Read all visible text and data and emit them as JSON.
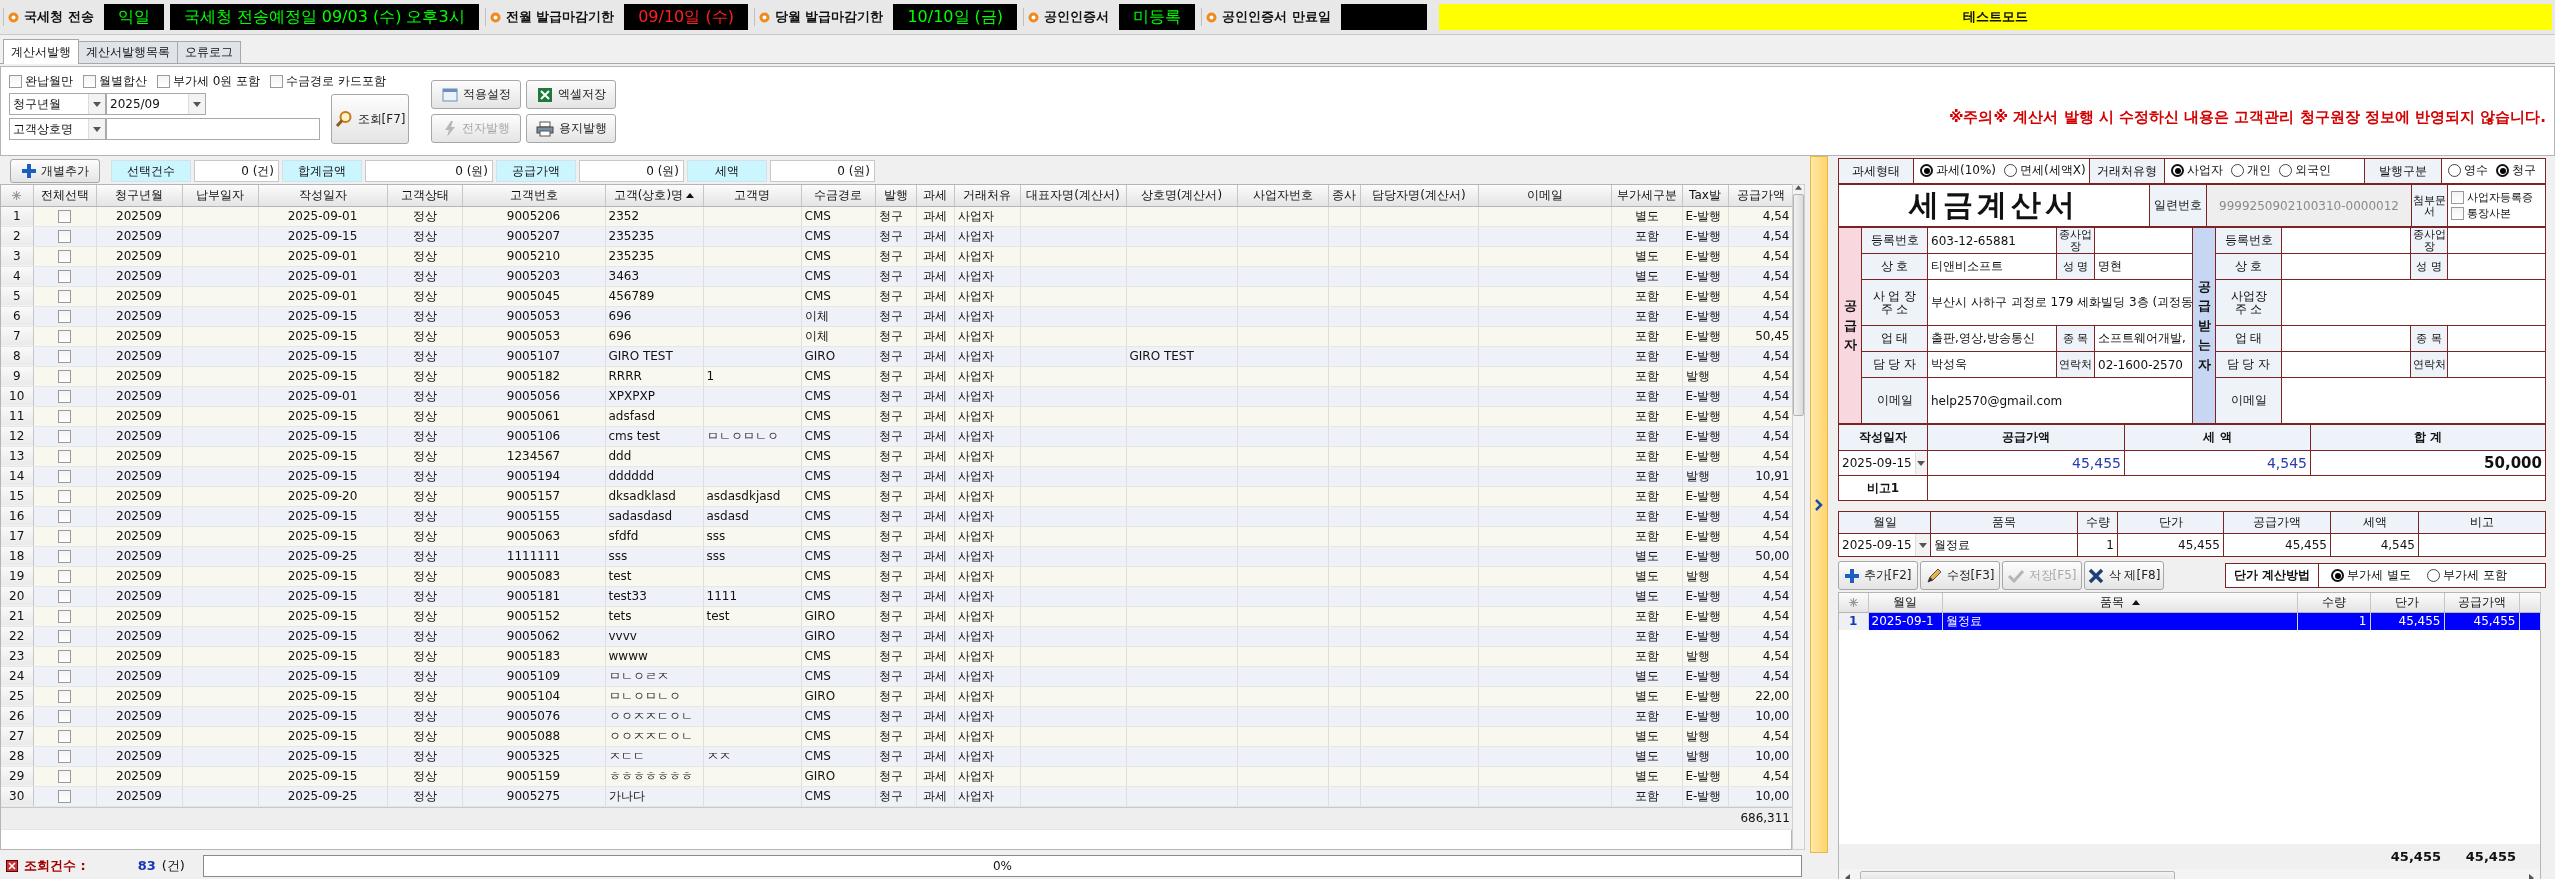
{
  "status_strip": {
    "items": [
      {
        "kind": "label",
        "text": "국세청 전송"
      },
      {
        "kind": "value",
        "text": "익일",
        "warning": false
      },
      {
        "kind": "value",
        "text": "국세청 전송예정일 09/03 (수) 오후3시",
        "warning": false
      },
      {
        "kind": "label",
        "text": "전월 발급마감기한"
      },
      {
        "kind": "value",
        "text": "09/10일 (수)",
        "warning": true
      },
      {
        "kind": "label",
        "text": "당월 발급마감기한"
      },
      {
        "kind": "value",
        "text": "10/10일 (금)",
        "warning": false
      },
      {
        "kind": "label",
        "text": "공인인증서"
      },
      {
        "kind": "value",
        "text": "미등록",
        "warning": false
      },
      {
        "kind": "label",
        "text": "공인인증서 만료일"
      },
      {
        "kind": "blank"
      }
    ],
    "mode_banner": "테스트모드"
  },
  "tabs": [
    {
      "label": "계산서발행",
      "selected": true
    },
    {
      "label": "계산서발행목록",
      "selected": false
    },
    {
      "label": "오류로그",
      "selected": false
    }
  ],
  "filter": {
    "checkboxes": [
      {
        "label": "완납월만",
        "checked": false
      },
      {
        "label": "월별합산",
        "checked": false
      },
      {
        "label": "부가세 0원 포함",
        "checked": false
      },
      {
        "label": "수금경로 카드포함",
        "checked": false
      }
    ],
    "period": {
      "type": "청구년월",
      "value": "2025/09"
    },
    "search": {
      "type": "고객상호명"
    },
    "search_button": {
      "label": "조회[F7]"
    },
    "buttons": [
      {
        "label": "적용설정",
        "kind": "apply",
        "disabled": false
      },
      {
        "label": "엑셀저장",
        "kind": "excel",
        "disabled": false
      },
      {
        "label": "전자발행",
        "kind": "esign",
        "disabled": true
      },
      {
        "label": "용지발행",
        "kind": "print",
        "disabled": false
      }
    ],
    "notice": "※주의※ 계산서 발행 시 수정하신 내용은 고객관리 청구원장 정보에 반영되지 않습니다."
  },
  "summary": {
    "add_button": "개별추가",
    "fields": [
      {
        "label": "선택건수",
        "value": "0 (건)"
      },
      {
        "label": "합계금액",
        "value": "0 (원)"
      },
      {
        "label": "공급가액",
        "value": "0 (원)"
      },
      {
        "label": "세액",
        "value": "0 (원)"
      }
    ]
  },
  "table": {
    "columns": [
      {
        "kind": "rownum",
        "sorted": false
      },
      {
        "kind": "check",
        "label": "전체선택",
        "sorted": false
      },
      {
        "label": "청구년월",
        "kind": "center",
        "sorted": false
      },
      {
        "label": "납부일자",
        "kind": "center",
        "sorted": false
      },
      {
        "label": "작성일자",
        "kind": "center",
        "sorted": false
      },
      {
        "label": "고객상태",
        "kind": "center",
        "sorted": false
      },
      {
        "label": "고객번호",
        "kind": "center",
        "sorted": false
      },
      {
        "label": "고객(상호)명",
        "kind": "text",
        "sorted": true
      },
      {
        "label": "고객명",
        "kind": "text",
        "sorted": false
      },
      {
        "label": "수금경로",
        "kind": "text",
        "sorted": false
      },
      {
        "label": "발행",
        "kind": "text",
        "sorted": false
      },
      {
        "label": "과세",
        "kind": "center",
        "sorted": false
      },
      {
        "label": "거래처유",
        "kind": "text",
        "sorted": false
      },
      {
        "label": "대표자명(계산서)",
        "kind": "text",
        "sorted": false
      },
      {
        "label": "상호명(계산서)",
        "kind": "text",
        "sorted": false
      },
      {
        "label": "사업자번호",
        "kind": "text",
        "sorted": false
      },
      {
        "label": "종사",
        "kind": "text",
        "sorted": false
      },
      {
        "label": "담당자명(계산서)",
        "kind": "text",
        "sorted": false
      },
      {
        "label": "이메일",
        "kind": "text",
        "sorted": false
      },
      {
        "label": "부가세구분",
        "kind": "center",
        "sorted": false
      },
      {
        "label": "Tax발",
        "kind": "text",
        "sorted": false
      },
      {
        "label": "공급가액",
        "kind": "number",
        "sorted": false
      }
    ],
    "rows": [
      {
        "num": "1",
        "checked": false,
        "billing_month": "202509",
        "issue_date": "2025-09-01",
        "status": "정상",
        "customer_no": "9005206",
        "customer_name": "2352",
        "route": "CMS",
        "issue_kind": "청구",
        "tax_form": "과세",
        "partner_type": "사업자",
        "vat": "별도",
        "tax_issue": "E-발행",
        "supply": "4,54"
      },
      {
        "num": "2",
        "checked": false,
        "billing_month": "202509",
        "issue_date": "2025-09-15",
        "status": "정상",
        "customer_no": "9005207",
        "customer_name": "235235",
        "route": "CMS",
        "issue_kind": "청구",
        "tax_form": "과세",
        "partner_type": "사업자",
        "vat": "포함",
        "tax_issue": "E-발행",
        "supply": "4,54"
      },
      {
        "num": "3",
        "checked": false,
        "billing_month": "202509",
        "issue_date": "2025-09-01",
        "status": "정상",
        "customer_no": "9005210",
        "customer_name": "235235",
        "route": "CMS",
        "issue_kind": "청구",
        "tax_form": "과세",
        "partner_type": "사업자",
        "vat": "별도",
        "tax_issue": "E-발행",
        "supply": "4,54"
      },
      {
        "num": "4",
        "checked": false,
        "billing_month": "202509",
        "issue_date": "2025-09-01",
        "status": "정상",
        "customer_no": "9005203",
        "customer_name": "3463",
        "route": "CMS",
        "issue_kind": "청구",
        "tax_form": "과세",
        "partner_type": "사업자",
        "vat": "별도",
        "tax_issue": "E-발행",
        "supply": "4,54"
      },
      {
        "num": "5",
        "checked": false,
        "billing_month": "202509",
        "issue_date": "2025-09-01",
        "status": "정상",
        "customer_no": "9005045",
        "customer_name": "456789",
        "route": "CMS",
        "issue_kind": "청구",
        "tax_form": "과세",
        "partner_type": "사업자",
        "vat": "포함",
        "tax_issue": "E-발행",
        "supply": "4,54"
      },
      {
        "num": "6",
        "checked": false,
        "billing_month": "202509",
        "issue_date": "2025-09-15",
        "status": "정상",
        "customer_no": "9005053",
        "customer_name": "696",
        "route": "이체",
        "issue_kind": "청구",
        "tax_form": "과세",
        "partner_type": "사업자",
        "vat": "포함",
        "tax_issue": "E-발행",
        "supply": "4,54"
      },
      {
        "num": "7",
        "checked": false,
        "billing_month": "202509",
        "issue_date": "2025-09-15",
        "status": "정상",
        "customer_no": "9005053",
        "customer_name": "696",
        "route": "이체",
        "issue_kind": "청구",
        "tax_form": "과세",
        "partner_type": "사업자",
        "vat": "포함",
        "tax_issue": "E-발행",
        "supply": "50,45"
      },
      {
        "num": "8",
        "checked": false,
        "billing_month": "202509",
        "issue_date": "2025-09-15",
        "status": "정상",
        "customer_no": "9005107",
        "customer_name": "GIRO TEST",
        "route": "GIRO",
        "issue_kind": "청구",
        "tax_form": "과세",
        "partner_type": "사업자",
        "company_name": "GIRO TEST",
        "vat": "포함",
        "tax_issue": "E-발행",
        "supply": "4,54"
      },
      {
        "num": "9",
        "checked": false,
        "billing_month": "202509",
        "issue_date": "2025-09-15",
        "status": "정상",
        "customer_no": "9005182",
        "customer_name": "RRRR",
        "contact_name": "1",
        "route": "CMS",
        "issue_kind": "청구",
        "tax_form": "과세",
        "partner_type": "사업자",
        "vat": "포함",
        "tax_issue": "발행",
        "supply": "4,54"
      },
      {
        "num": "10",
        "checked": false,
        "billing_month": "202509",
        "issue_date": "2025-09-01",
        "status": "정상",
        "customer_no": "9005056",
        "customer_name": "XPXPXP",
        "route": "CMS",
        "issue_kind": "청구",
        "tax_form": "과세",
        "partner_type": "사업자",
        "vat": "포함",
        "tax_issue": "E-발행",
        "supply": "4,54"
      },
      {
        "num": "11",
        "checked": false,
        "billing_month": "202509",
        "issue_date": "2025-09-15",
        "status": "정상",
        "customer_no": "9005061",
        "customer_name": "adsfasd",
        "route": "CMS",
        "issue_kind": "청구",
        "tax_form": "과세",
        "partner_type": "사업자",
        "vat": "포함",
        "tax_issue": "E-발행",
        "supply": "4,54"
      },
      {
        "num": "12",
        "checked": false,
        "billing_month": "202509",
        "issue_date": "2025-09-15",
        "status": "정상",
        "customer_no": "9005106",
        "customer_name": "cms test",
        "contact_name": "ㅁㄴㅇㅁㄴㅇ",
        "route": "CMS",
        "issue_kind": "청구",
        "tax_form": "과세",
        "partner_type": "사업자",
        "vat": "포함",
        "tax_issue": "E-발행",
        "supply": "4,54"
      },
      {
        "num": "13",
        "checked": false,
        "billing_month": "202509",
        "issue_date": "2025-09-15",
        "status": "정상",
        "customer_no": "1234567",
        "customer_name": "ddd",
        "route": "CMS",
        "issue_kind": "청구",
        "tax_form": "과세",
        "partner_type": "사업자",
        "vat": "포함",
        "tax_issue": "E-발행",
        "supply": "4,54"
      },
      {
        "num": "14",
        "checked": false,
        "billing_month": "202509",
        "issue_date": "2025-09-15",
        "status": "정상",
        "customer_no": "9005194",
        "customer_name": "dddddd",
        "route": "CMS",
        "issue_kind": "청구",
        "tax_form": "과세",
        "partner_type": "사업자",
        "vat": "포함",
        "tax_issue": "발행",
        "supply": "10,91"
      },
      {
        "num": "15",
        "checked": false,
        "billing_month": "202509",
        "issue_date": "2025-09-20",
        "status": "정상",
        "customer_no": "9005157",
        "customer_name": "dksadklasd",
        "contact_name": "asdasdkjasd",
        "route": "CMS",
        "issue_kind": "청구",
        "tax_form": "과세",
        "partner_type": "사업자",
        "vat": "포함",
        "tax_issue": "E-발행",
        "supply": "4,54"
      },
      {
        "num": "16",
        "checked": false,
        "billing_month": "202509",
        "issue_date": "2025-09-15",
        "status": "정상",
        "customer_no": "9005155",
        "customer_name": "sadasdasd",
        "contact_name": "asdasd",
        "route": "CMS",
        "issue_kind": "청구",
        "tax_form": "과세",
        "partner_type": "사업자",
        "vat": "포함",
        "tax_issue": "E-발행",
        "supply": "4,54"
      },
      {
        "num": "17",
        "checked": false,
        "billing_month": "202509",
        "issue_date": "2025-09-15",
        "status": "정상",
        "customer_no": "9005063",
        "customer_name": "sfdfd",
        "contact_name": "sss",
        "route": "CMS",
        "issue_kind": "청구",
        "tax_form": "과세",
        "partner_type": "사업자",
        "vat": "포함",
        "tax_issue": "E-발행",
        "supply": "4,54"
      },
      {
        "num": "18",
        "checked": false,
        "billing_month": "202509",
        "issue_date": "2025-09-25",
        "status": "정상",
        "customer_no": "1111111",
        "customer_name": "sss",
        "contact_name": "sss",
        "route": "CMS",
        "issue_kind": "청구",
        "tax_form": "과세",
        "partner_type": "사업자",
        "vat": "별도",
        "tax_issue": "E-발행",
        "supply": "50,00"
      },
      {
        "num": "19",
        "checked": false,
        "billing_month": "202509",
        "issue_date": "2025-09-15",
        "status": "정상",
        "customer_no": "9005083",
        "customer_name": "test",
        "route": "CMS",
        "issue_kind": "청구",
        "tax_form": "과세",
        "partner_type": "사업자",
        "vat": "별도",
        "tax_issue": "발행",
        "supply": "4,54"
      },
      {
        "num": "20",
        "checked": false,
        "billing_month": "202509",
        "issue_date": "2025-09-15",
        "status": "정상",
        "customer_no": "9005181",
        "customer_name": "test33",
        "contact_name": "1111",
        "route": "CMS",
        "issue_kind": "청구",
        "tax_form": "과세",
        "partner_type": "사업자",
        "vat": "별도",
        "tax_issue": "E-발행",
        "supply": "4,54"
      },
      {
        "num": "21",
        "checked": false,
        "billing_month": "202509",
        "issue_date": "2025-09-15",
        "status": "정상",
        "customer_no": "9005152",
        "customer_name": "tets",
        "contact_name": "test",
        "route": "GIRO",
        "issue_kind": "청구",
        "tax_form": "과세",
        "partner_type": "사업자",
        "vat": "포함",
        "tax_issue": "E-발행",
        "supply": "4,54"
      },
      {
        "num": "22",
        "checked": false,
        "billing_month": "202509",
        "issue_date": "2025-09-15",
        "status": "정상",
        "customer_no": "9005062",
        "customer_name": "vvvv",
        "route": "GIRO",
        "issue_kind": "청구",
        "tax_form": "과세",
        "partner_type": "사업자",
        "vat": "포함",
        "tax_issue": "E-발행",
        "supply": "4,54"
      },
      {
        "num": "23",
        "checked": false,
        "billing_month": "202509",
        "issue_date": "2025-09-15",
        "status": "정상",
        "customer_no": "9005183",
        "customer_name": "wwww",
        "route": "CMS",
        "issue_kind": "청구",
        "tax_form": "과세",
        "partner_type": "사업자",
        "vat": "포함",
        "tax_issue": "발행",
        "supply": "4,54"
      },
      {
        "num": "24",
        "checked": false,
        "billing_month": "202509",
        "issue_date": "2025-09-15",
        "status": "정상",
        "customer_no": "9005109",
        "customer_name": "ㅁㄴㅇㄹㅈ",
        "route": "CMS",
        "issue_kind": "청구",
        "tax_form": "과세",
        "partner_type": "사업자",
        "vat": "별도",
        "tax_issue": "E-발행",
        "supply": "4,54"
      },
      {
        "num": "25",
        "checked": false,
        "billing_month": "202509",
        "issue_date": "2025-09-15",
        "status": "정상",
        "customer_no": "9005104",
        "customer_name": "ㅁㄴㅇㅁㄴㅇ",
        "route": "GIRO",
        "issue_kind": "청구",
        "tax_form": "과세",
        "partner_type": "사업자",
        "vat": "별도",
        "tax_issue": "E-발행",
        "supply": "22,00"
      },
      {
        "num": "26",
        "checked": false,
        "billing_month": "202509",
        "issue_date": "2025-09-15",
        "status": "정상",
        "customer_no": "9005076",
        "customer_name": "ㅇㅇㅈㅈㄷㅇㄴ",
        "route": "CMS",
        "issue_kind": "청구",
        "tax_form": "과세",
        "partner_type": "사업자",
        "vat": "포함",
        "tax_issue": "E-발행",
        "supply": "10,00"
      },
      {
        "num": "27",
        "checked": false,
        "billing_month": "202509",
        "issue_date": "2025-09-15",
        "status": "정상",
        "customer_no": "9005088",
        "customer_name": "ㅇㅇㅈㅈㄷㅇㄴ",
        "route": "CMS",
        "issue_kind": "청구",
        "tax_form": "과세",
        "partner_type": "사업자",
        "vat": "별도",
        "tax_issue": "발행",
        "supply": "4,54"
      },
      {
        "num": "28",
        "checked": false,
        "billing_month": "202509",
        "issue_date": "2025-09-15",
        "status": "정상",
        "customer_no": "9005325",
        "customer_name": "ㅈㄷㄷ",
        "contact_name": "ㅈㅈ",
        "route": "CMS",
        "issue_kind": "청구",
        "tax_form": "과세",
        "partner_type": "사업자",
        "vat": "별도",
        "tax_issue": "발행",
        "supply": "10,00"
      },
      {
        "num": "29",
        "checked": false,
        "billing_month": "202509",
        "issue_date": "2025-09-15",
        "status": "정상",
        "customer_no": "9005159",
        "customer_name": "ㅎㅎㅎㅎㅎㅎㅎ",
        "route": "GIRO",
        "issue_kind": "청구",
        "tax_form": "과세",
        "partner_type": "사업자",
        "vat": "별도",
        "tax_issue": "E-발행",
        "supply": "4,54"
      },
      {
        "num": "30",
        "checked": false,
        "billing_month": "202509",
        "issue_date": "2025-09-25",
        "status": "정상",
        "customer_no": "9005275",
        "customer_name": "가나다",
        "route": "CMS",
        "issue_kind": "청구",
        "tax_form": "과세",
        "partner_type": "사업자",
        "vat": "포함",
        "tax_issue": "E-발행",
        "supply": "10,00"
      }
    ],
    "footer": {
      "supply": "686,311"
    }
  },
  "status_bar": {
    "label": "조회건수 :",
    "count": "83",
    "unit": "(건)",
    "progress": {
      "level": 0,
      "reading": "0%"
    }
  },
  "invoice": {
    "options": [
      {
        "label": "과세형태",
        "choices": [
          {
            "label": "과세(10%)",
            "selected": true
          },
          {
            "label": "면세(세액X)",
            "selected": false
          }
        ]
      },
      {
        "label": "거래처유형",
        "choices": [
          {
            "label": "사업자",
            "selected": true
          },
          {
            "label": "개인",
            "selected": false
          },
          {
            "label": "외국인",
            "selected": false
          }
        ]
      },
      {
        "label": "발행구분",
        "choices": [
          {
            "label": "영수",
            "selected": false
          },
          {
            "label": "청구",
            "selected": true
          }
        ]
      }
    ],
    "title": "세금계산서",
    "serial_label": "일련번호",
    "serial": "9999250902100310-0000012",
    "attachments_label": "첨부문서",
    "attachments": [
      {
        "label": "사업자등록증",
        "checked": false
      },
      {
        "label": "통장사본",
        "checked": false
      }
    ],
    "parties": [
      {
        "heading": "공급자",
        "color": "#f8d7df",
        "rows": [
          {
            "label": "등록번호",
            "value": "603-12-65881",
            "label2": "종사업장"
          },
          {
            "label": "상 호",
            "value": "티앤비소프트",
            "label2": "성 명",
            "value2": "명현"
          },
          {
            "label": "사 업 장\n주 소",
            "value": "부산시 사하구 괴정로 179 세화빌딩 3층 (괴정동"
          },
          {
            "label": "업 태",
            "value": "출판,영상,방송통신",
            "label2": "종 목",
            "value2": "소프트웨어개발,"
          },
          {
            "label": "담 당 자",
            "value": "박성욱",
            "label2": "연락처",
            "value2": "02-1600-2570"
          },
          {
            "label": "이메일",
            "value": "help2570@gmail.com"
          }
        ]
      },
      {
        "heading": "공급받는자",
        "color": "#c6d6f3",
        "rows": [
          {
            "label": "등록번호",
            "label2": "종사업장"
          },
          {
            "label": "상 호",
            "label2": "성 명"
          },
          {
            "label": "사업장\n주 소"
          },
          {
            "label": "업 태",
            "label2": "종 목"
          },
          {
            "label": "담 당 자",
            "label2": "연락처"
          },
          {
            "label": "이메일"
          }
        ]
      }
    ],
    "totals": {
      "columns": [
        "작성일자",
        "공급가액",
        "세 액",
        "합 계"
      ],
      "date": "2025-09-15",
      "supply": "45,455",
      "tax": "4,545",
      "total": "50,000",
      "remark_label": "비고1"
    },
    "items": {
      "columns": [
        {
          "label": "월일",
          "kind": "date"
        },
        {
          "label": "품목",
          "kind": "text"
        },
        {
          "label": "수량",
          "kind": "number"
        },
        {
          "label": "단가",
          "kind": "number"
        },
        {
          "label": "공급가액",
          "kind": "number"
        },
        {
          "label": "세액",
          "kind": "number"
        },
        {
          "label": "비고",
          "kind": "text"
        }
      ],
      "rows": [
        {
          "date": "2025-09-15",
          "item": "월정료",
          "qty": "1",
          "unit_price": "45,455",
          "supply": "45,455",
          "tax": "4,545"
        }
      ]
    },
    "buttons": [
      {
        "label": "추가[F2]",
        "kind": "add",
        "disabled": false
      },
      {
        "label": "수정[F3]",
        "kind": "edit",
        "disabled": false
      },
      {
        "label": "저장[F5]",
        "kind": "save",
        "disabled": true
      },
      {
        "label": "삭 제[F8]",
        "kind": "delete",
        "disabled": false
      }
    ],
    "calc_method": {
      "label": "단가 계산방법",
      "choices": [
        {
          "label": "부가세 별도",
          "selected": true
        },
        {
          "label": "부가세 포함",
          "selected": false
        }
      ]
    },
    "detail": {
      "columns": [
        {
          "label": "월일",
          "kind": "text",
          "sorted": false
        },
        {
          "label": "품목",
          "kind": "text",
          "sorted": true
        },
        {
          "label": "수량",
          "kind": "number",
          "sorted": false
        },
        {
          "label": "단가",
          "kind": "number",
          "sorted": false
        },
        {
          "label": "공급가액",
          "kind": "number",
          "sorted": false
        }
      ],
      "rows": [
        {
          "num": "1",
          "selected": true,
          "date": "2025-09-1",
          "item": "월정료",
          "qty": "1",
          "unit_price": "45,455",
          "supply": "45,455"
        }
      ],
      "totals": {
        "unit_price": "45,455",
        "supply": "45,455"
      }
    }
  }
}
